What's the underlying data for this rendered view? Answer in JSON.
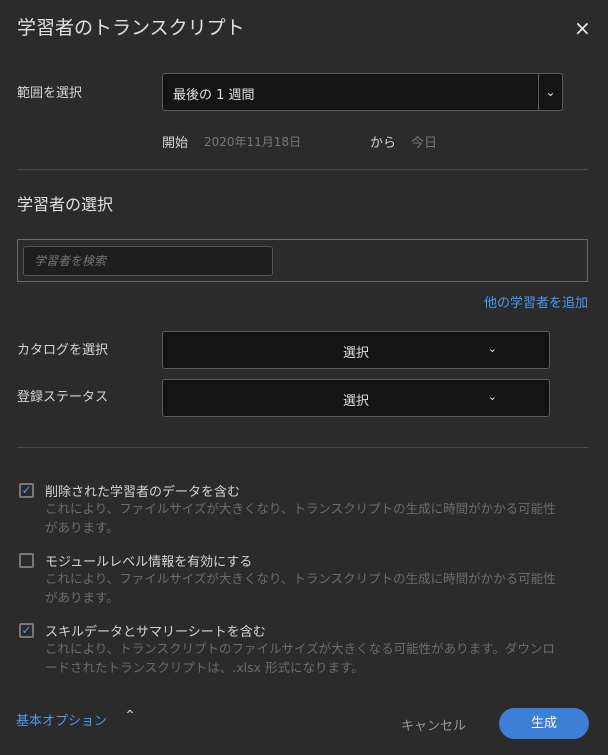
{
  "dialog": {
    "title": "学習者のトランスクリプト",
    "close_icon": "×"
  },
  "range": {
    "label": "範囲を選択",
    "value": "最後の 1 週間",
    "start_label": "開始",
    "start_date": "2020年11月18日",
    "to_label": "から",
    "end_date": "今日"
  },
  "learners": {
    "heading": "学習者の選択",
    "search_placeholder": "学習者を検索",
    "add_link": "他の学習者を追加"
  },
  "catalog": {
    "label": "カタログを選択",
    "value": "選択"
  },
  "enrollment": {
    "label": "登録ステータス",
    "value": "選択"
  },
  "options": [
    {
      "label": "削除された学習者のデータを含む",
      "checked": true,
      "desc": "これにより、ファイルサイズが大きくなり、トランスクリプトの生成に時間がかかる可能性があります。"
    },
    {
      "label": "モジュールレベル情報を有効にする",
      "checked": false,
      "desc": "これにより、ファイルサイズが大きくなり、トランスクリプトの生成に時間がかかる可能性があります。"
    },
    {
      "label": "スキルデータとサマリーシートを含む",
      "checked": true,
      "desc": "これにより、トランスクリプトのファイルサイズが大きくなる可能性があります。ダウンロードされたトランスクリプトは、.xlsx 形式になります。"
    }
  ],
  "footer": {
    "basic_options": "基本オプション",
    "cancel": "キャンセル",
    "generate": "生成"
  },
  "colors": {
    "accent": "#3d7fd6",
    "link": "#4b9bf0"
  }
}
